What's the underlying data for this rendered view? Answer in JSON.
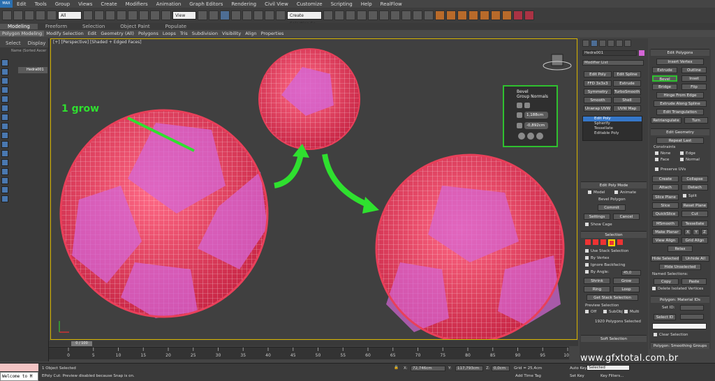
{
  "menu": [
    "Edit",
    "Tools",
    "Group",
    "Views",
    "Create",
    "Modifiers",
    "Animation",
    "Graph Editors",
    "Rendering",
    "Civil View",
    "Customize",
    "Scripting",
    "Help",
    "RealFlow"
  ],
  "app_logo": "MAX",
  "toolbar": {
    "filter_select": "All",
    "view_select": "View",
    "selection_set": "Create Selection Se"
  },
  "ribbon_tabs": [
    "Modeling",
    "Freeform",
    "Selection",
    "Object Paint",
    "Populate"
  ],
  "ribbon_items": [
    "Polygon Modeling",
    "Modify Selection",
    "Edit",
    "Geometry (All)",
    "Polygons",
    "Loops",
    "Tris",
    "Subdivision",
    "Visibility",
    "Align",
    "Properties"
  ],
  "scene": {
    "tabs": [
      "Select",
      "Display"
    ],
    "column": "Name (Sorted Ascer",
    "object": "Hedra001"
  },
  "viewport": {
    "label": "[+] [Perspective] [Shaded + Edged Faces]",
    "annotation": "1 grow"
  },
  "bevel_caddy": {
    "title": "Bevel",
    "mode": "Group Normals",
    "height": "1,188cm",
    "outline": "-0,892cm"
  },
  "command": {
    "object_name": "Hedra001",
    "modifier_list": "Modifier List",
    "mod_buttons": [
      "Edit Poly",
      "Edit Spline",
      "FFD 3x3x3",
      "Extrude",
      "Symmetry",
      "TurboSmooth",
      "Smooth",
      "Shell",
      "Unwrap UVW",
      "UVW Map"
    ],
    "stack": [
      "Edit Poly",
      "Spherify",
      "Tessellate",
      "Editable Poly"
    ],
    "edit_poly_mode": {
      "title": "Edit Poly Mode",
      "model": "Model",
      "animate": "Animate",
      "op": "Bevel Polygon",
      "commit": "Commit",
      "settings": "Settings",
      "cancel": "Cancel",
      "show_cage": "Show Cage"
    },
    "selection": {
      "title": "Selection",
      "use_stack": "Use Stack Selection",
      "by_vertex": "By Vertex",
      "ignore_backfacing": "Ignore Backfacing",
      "by_angle": "By Angle:",
      "by_angle_val": "45,0",
      "shrink": "Shrink",
      "grow": "Grow",
      "ring": "Ring",
      "loop": "Loop",
      "get_stack": "Get Stack Selection",
      "preview": "Preview Selection",
      "off": "Off",
      "subobj": "SubObj",
      "multi": "Multi",
      "count": "1920 Polygons Selected"
    },
    "soft_selection": "Soft Selection"
  },
  "edit_polygons": {
    "title": "Edit Polygons",
    "insert_vertex": "Insert Vertex",
    "extrude": "Extrude",
    "outline": "Outline",
    "bevel": "Bevel",
    "inset": "Inset",
    "bridge": "Bridge",
    "flip": "Flip",
    "hinge": "Hinge From Edge",
    "extrude_spline": "Extrude Along Spline",
    "edit_tri": "Edit Triangulation",
    "retriangulate": "Retriangulate",
    "turn": "Turn"
  },
  "edit_geometry": {
    "title": "Edit Geometry",
    "repeat": "Repeat Last",
    "constraints": "Constraints",
    "none": "None",
    "edge": "Edge",
    "face": "Face",
    "normal": "Normal",
    "preserve": "Preserve UVs",
    "create": "Create",
    "collapse": "Collapse",
    "attach": "Attach",
    "detach": "Detach",
    "slice_plane": "Slice Plane",
    "split": "Split",
    "slice": "Slice",
    "reset_plane": "Reset Plane",
    "quickslice": "QuickSlice",
    "cut": "Cut",
    "msmooth": "MSmooth",
    "tessellate": "Tessellate",
    "make_planar": "Make Planar",
    "x": "X",
    "y": "Y",
    "z": "Z",
    "view_align": "View Align",
    "grid_align": "Grid Align",
    "relax": "Relax",
    "hide_sel": "Hide Selected",
    "unhide": "Unhide All",
    "hide_unsel": "Hide Unselected",
    "named": "Named Selections:",
    "copy": "Copy",
    "paste": "Paste",
    "delete_iso": "Delete Isolated Vertices"
  },
  "material": {
    "title": "Polygon: Material IDs",
    "set_id": "Set ID:",
    "select_id": "Select ID",
    "clear": "Clear Selection"
  },
  "smoothing_title": "Polygon: Smoothing Groups",
  "timeline": {
    "frame": "0 / 100",
    "ticks": [
      "0",
      "5",
      "10",
      "15",
      "20",
      "25",
      "30",
      "35",
      "40",
      "45",
      "50",
      "55",
      "60",
      "65",
      "70",
      "75",
      "80",
      "85",
      "90",
      "95",
      "100"
    ]
  },
  "status": {
    "objects": "1 Object Selected",
    "prompt": "EPoly Cut: Preview disabled because Snap is on.",
    "x": "72,746cm",
    "y": "117,793cm",
    "z": "0,0cm",
    "grid": "Grid = 25,4cm",
    "autokey": "Auto Key",
    "selected": "Selected",
    "setkey": "Set Key",
    "keyfilters": "Key Filters...",
    "addtime": "Add Time Tag",
    "listener": "Welcome to M"
  },
  "watermark": "www.gfxtotal.com.br",
  "colors": {
    "accent_green": "#2fe02f",
    "poly_red": "#e8405a",
    "poly_pink": "#d465d6",
    "highlight": "#2fc02f"
  }
}
